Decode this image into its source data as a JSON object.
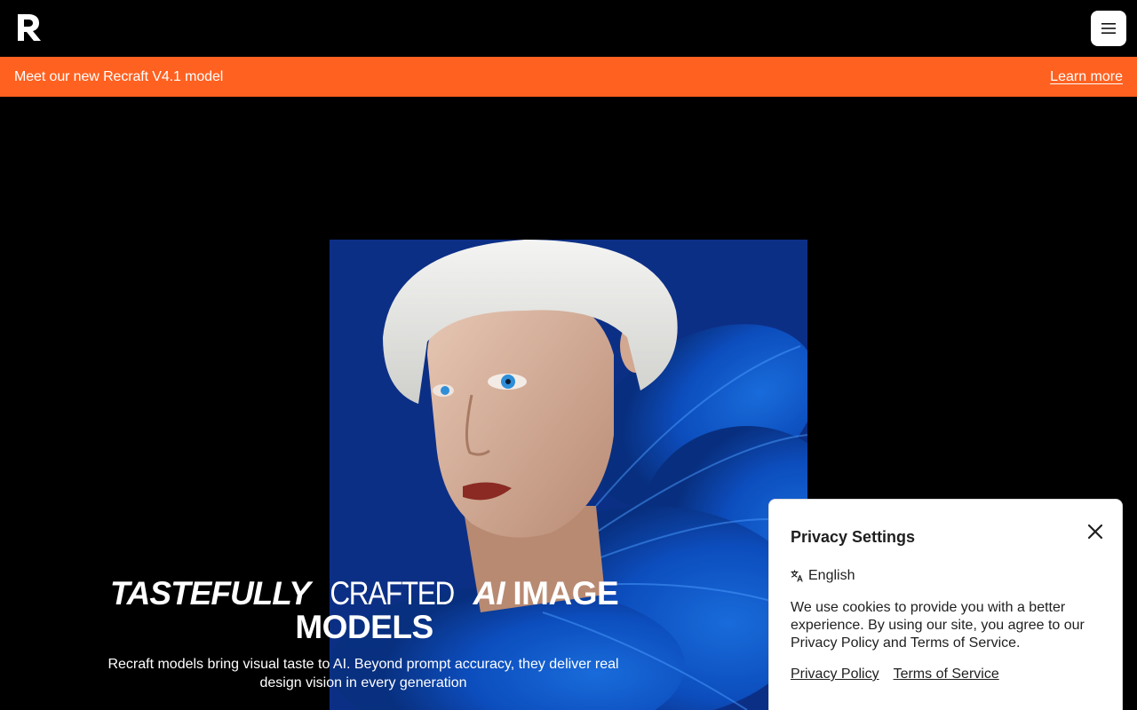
{
  "header": {
    "logo_icon": "recraft-logo-icon",
    "menu_icon": "hamburger-menu-icon"
  },
  "banner": {
    "text": "Meet our new Recraft V4.1 model",
    "link_label": "Learn more",
    "color": "#ff6120"
  },
  "hero": {
    "headline_part1": "TASTEFULLY",
    "headline_part2": "CRAFTED",
    "headline_part3": "AI",
    "headline_part4": "IMAGE MODELS",
    "subtext": "Recraft models bring visual taste to AI. Beyond prompt accuracy, they deliver real design vision in every generation",
    "image_desc_icon": "hero-portrait-image"
  },
  "privacy": {
    "title": "Privacy Settings",
    "language": "English",
    "body": "We use cookies to provide you with a better experience. By using our site, you agree to our Privacy Policy and Terms of Service.",
    "privacy_policy_link": "Privacy Policy",
    "terms_link": "Terms of Service",
    "close_icon": "close-icon",
    "language_icon": "translate-icon"
  }
}
